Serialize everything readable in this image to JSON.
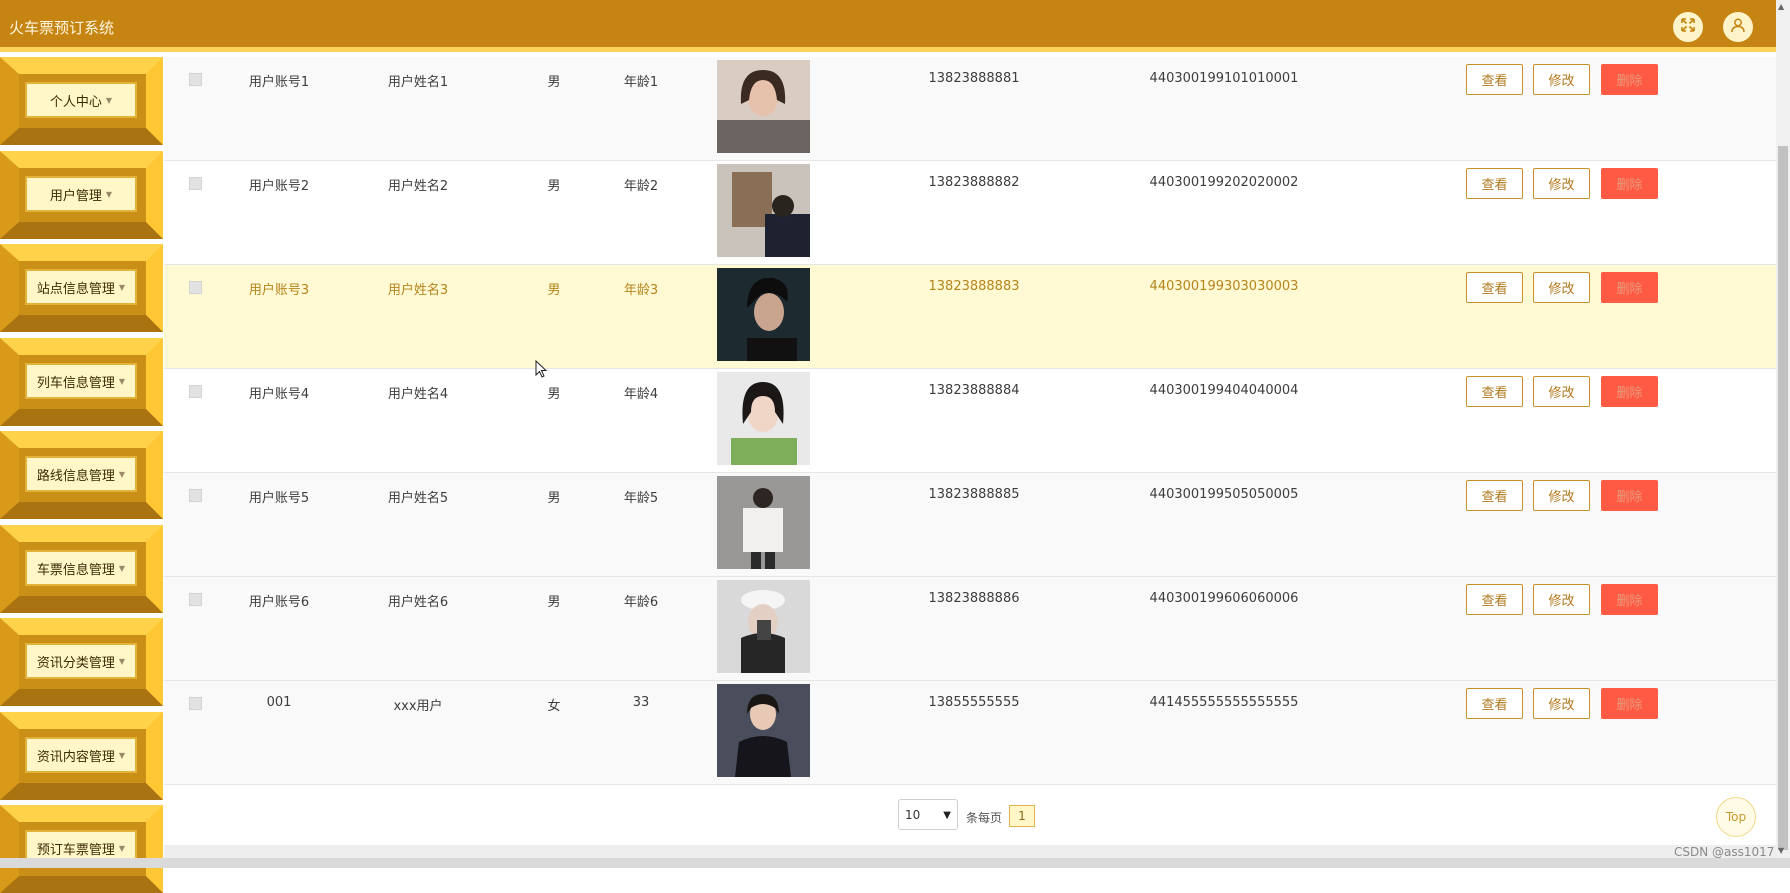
{
  "app": {
    "title": "火车票预订系统"
  },
  "header": {
    "fullscreen_icon": "expand-icon",
    "user_icon": "user-icon"
  },
  "sidebar": {
    "items": [
      {
        "label": "个人中心"
      },
      {
        "label": "用户管理"
      },
      {
        "label": "站点信息管理"
      },
      {
        "label": "列车信息管理"
      },
      {
        "label": "路线信息管理"
      },
      {
        "label": "车票信息管理"
      },
      {
        "label": "资讯分类管理"
      },
      {
        "label": "资讯内容管理"
      },
      {
        "label": "预订车票管理"
      }
    ]
  },
  "actions": {
    "view": "查看",
    "edit": "修改",
    "delete": "删除"
  },
  "rows": [
    {
      "account": "用户账号1",
      "name": "用户姓名1",
      "gender": "男",
      "age": "年龄1",
      "phone": "13823888881",
      "id_card": "440300199101010001"
    },
    {
      "account": "用户账号2",
      "name": "用户姓名2",
      "gender": "男",
      "age": "年龄2",
      "phone": "13823888882",
      "id_card": "440300199202020002"
    },
    {
      "account": "用户账号3",
      "name": "用户姓名3",
      "gender": "男",
      "age": "年龄3",
      "phone": "13823888883",
      "id_card": "440300199303030003"
    },
    {
      "account": "用户账号4",
      "name": "用户姓名4",
      "gender": "男",
      "age": "年龄4",
      "phone": "13823888884",
      "id_card": "440300199404040004"
    },
    {
      "account": "用户账号5",
      "name": "用户姓名5",
      "gender": "男",
      "age": "年龄5",
      "phone": "13823888885",
      "id_card": "440300199505050005"
    },
    {
      "account": "用户账号6",
      "name": "用户姓名6",
      "gender": "男",
      "age": "年龄6",
      "phone": "13823888886",
      "id_card": "440300199606060006"
    },
    {
      "account": "001",
      "name": "xxx用户",
      "gender": "女",
      "age": "33",
      "phone": "13855555555",
      "id_card": "441455555555555555"
    }
  ],
  "pagination": {
    "page_size": "10",
    "per_page_label": "条每页",
    "current_page": "1"
  },
  "top_button": "Top",
  "watermark": "CSDN @ass1017"
}
